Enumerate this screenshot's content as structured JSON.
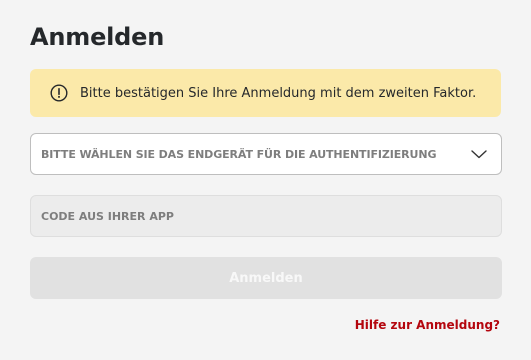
{
  "page": {
    "title": "Anmelden"
  },
  "alert": {
    "icon": "exclamation-circle-icon",
    "text": "Bitte bestätigen Sie Ihre Anmeldung mit dem zweiten Faktor."
  },
  "device_select": {
    "label": "BITTE WÄHLEN SIE DAS ENDGERÄT FÜR DIE AUTHENTIFIZIERUNG",
    "icon": "chevron-down-icon"
  },
  "code_field": {
    "placeholder": "CODE AUS IHRER APP",
    "value": ""
  },
  "submit_button": {
    "label": "Anmelden",
    "disabled": true
  },
  "help_link": {
    "label": "Hilfe zur Anmeldung?"
  },
  "colors": {
    "background": "#f4f4f4",
    "alert_background": "#fbe9a9",
    "text_primary": "#25282b",
    "text_muted": "#7e7e7e",
    "link": "#b4060e",
    "button_disabled": "#e1e1e1"
  }
}
